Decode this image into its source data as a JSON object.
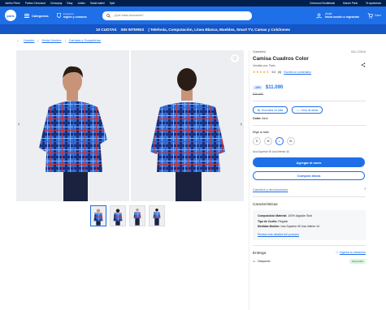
{
  "topbar": {
    "links": [
      "Jumbo Prime",
      "Puntos Cencosud",
      "Cencopay",
      "Easy",
      "Jumbo",
      "Santa Isabel",
      "Spid"
    ],
    "right": [
      "Cencosud Scotiabank",
      "Mundo Paris",
      "Te ayudamos"
    ]
  },
  "header": {
    "logo": "paris",
    "categories": "Categorías",
    "location_label": "Ingresa tu",
    "location_value": "región y comuna",
    "search_placeholder": "¿Qué estás buscando?",
    "user_greeting": "¡Hola!",
    "user_action": "Inicia sesión o regístrate",
    "cart_label": "Carro"
  },
  "promo": {
    "cuotas": "10 CUOTAS",
    "interes": "SIN INTERES",
    "text": "| Telefonía, Computación, Línea Blanca, Muebles, Smart TV, Camas y Colchones"
  },
  "breadcrumb": {
    "items": [
      "Hombre",
      "Moda Hombre",
      "Camisas y Guayaberas"
    ]
  },
  "product": {
    "brand": "Greenfield",
    "sku": "SKU 123415",
    "title": "Camisa Cuadros Color",
    "seller": "Vendido por: Paris",
    "rating": "5.0",
    "reviews": "(5)",
    "rating_link": "Escribe un comentario",
    "discount": "-10%",
    "price": "$11.090",
    "old_price": "$20.990",
    "fit_button": "Encontrar mi talla",
    "guide_button": "Guía de tallas",
    "color_label": "Color:",
    "color_value": "Azul",
    "size_label": "Elige tu talla",
    "sizes": [
      "S",
      "M",
      "L",
      "XL"
    ],
    "selected_size": "L",
    "model_info": "Usa Superior M/ Usa Inferior 44",
    "add_to_cart": "Agregar al carro",
    "buy_now": "Comprar ahora",
    "returns_link": "Cambios y devoluciones",
    "features_title": "Características",
    "specs": [
      {
        "k": "Composición Material:",
        "v": "100% Algodón Slub"
      },
      {
        "k": "Tipo de Cuello:",
        "v": "Regular"
      },
      {
        "k": "Medidas Modelo:",
        "v": "Usa Superior M/ Usa Inferior 44"
      }
    ],
    "specs_link": "Revisar más detalles del producto",
    "delivery_title": "Entrega",
    "delivery_link": "Ingresa tu ubicación",
    "shipping_label": "Despacho",
    "shipping_status": "Disponible"
  },
  "colors": {
    "accent": "#1e6fe8",
    "header": "#1e6fe8",
    "promo": "#1555c4",
    "topbar": "#001f4d"
  }
}
